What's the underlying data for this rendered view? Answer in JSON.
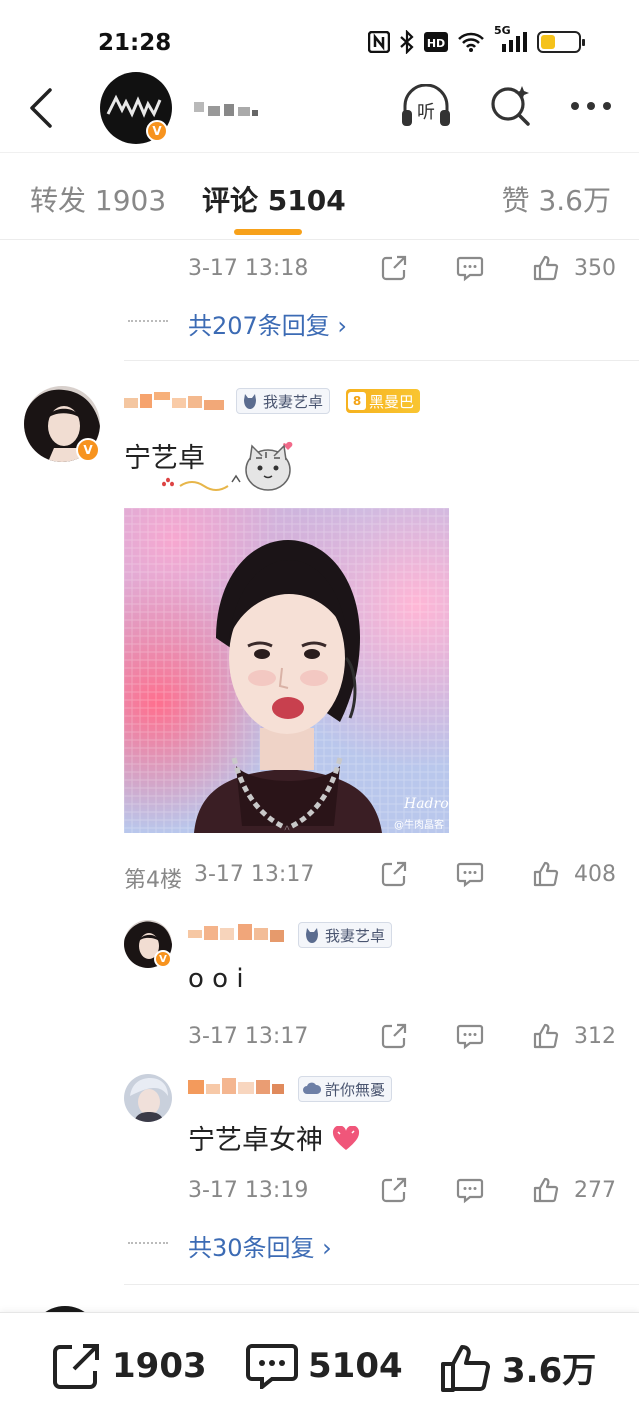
{
  "status_bar": {
    "time": "21:28",
    "network": "5G"
  },
  "nav": {
    "post_author_name": ""
  },
  "tabs": [
    {
      "label": "转发 1903",
      "active": false
    },
    {
      "label": "评论 5104",
      "active": true
    },
    {
      "label": "赞 3.6万",
      "active": false
    }
  ],
  "colors": {
    "accent": "#f7a11a",
    "link": "#3c6bb4",
    "vip_badge": "#f7931e",
    "gold_tag": "#f6b21f"
  },
  "prev_comment": {
    "timestamp": "3-17 13:18",
    "likes": "350",
    "more_replies": "共207条回复 ›"
  },
  "comment": {
    "fan_tag": "我妻艺卓",
    "level_tag": "8",
    "level_tag_label": "黑曼巴",
    "text": "宁艺卓",
    "floor": "第4楼",
    "timestamp": "3-17 13:17",
    "likes": "408",
    "photo_watermark": "@牛肉晶客",
    "photo_signature": "Hadro",
    "replies": [
      {
        "fan_tag": "我妻艺卓",
        "text": "o o i",
        "timestamp": "3-17 13:17",
        "likes": "312"
      },
      {
        "fan_tag": "許你無憂",
        "text": "宁艺卓女神",
        "timestamp": "3-17 13:19",
        "likes": "277"
      }
    ],
    "more_replies": "共30条回复 ›"
  },
  "bottom_bar": {
    "reposts": "1903",
    "comments": "5104",
    "likes": "3.6万"
  }
}
